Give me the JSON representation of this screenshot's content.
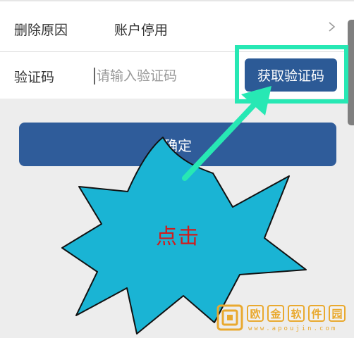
{
  "form": {
    "reason_label": "删除原因",
    "reason_value": "账户停用",
    "code_label": "验证码",
    "code_value": "",
    "code_placeholder": "请输入验证码",
    "get_code_label": "获取验证码"
  },
  "confirm_label": "确定",
  "annotation": {
    "callout_text": "点击"
  },
  "watermark": {
    "chars": [
      "欧",
      "金",
      "软",
      "件",
      "园"
    ],
    "url": "www.apoujin.com"
  },
  "colors": {
    "primary_button": "#2c5a96",
    "highlight_box": "#27e8b4",
    "callout_fill": "#1ab4d4",
    "callout_text": "#d11c1c",
    "watermark": "#e9a92f"
  },
  "icons": {
    "reason_chevron": "chevron-right-icon",
    "watermark_logo": "watermark-logo-icon"
  }
}
